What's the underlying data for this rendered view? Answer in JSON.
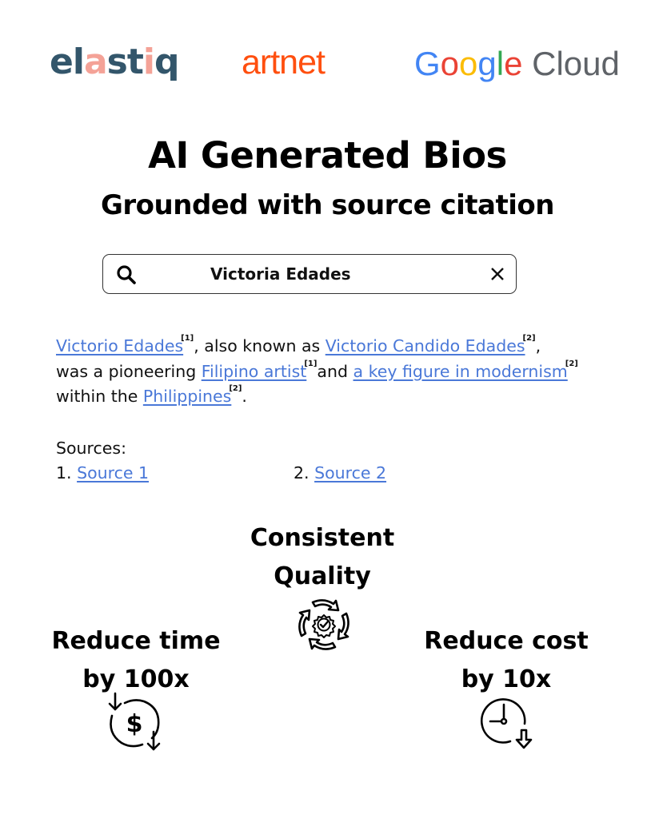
{
  "logos": {
    "elastiq": {
      "parts": [
        "el",
        "a",
        "st",
        "i",
        "q"
      ],
      "colors": {
        "primary": "#33566b",
        "accent": "#f4a297"
      }
    },
    "artnet": {
      "text": "artnet",
      "color": "#ff4f0f"
    },
    "google_cloud": {
      "google": [
        "G",
        "o",
        "o",
        "g",
        "l",
        "e"
      ],
      "cloud": "Cloud"
    }
  },
  "header": {
    "title": "AI Generated Bios",
    "subtitle": "Grounded with source citation"
  },
  "search": {
    "value": "Victoria Edades",
    "icon": "search-icon",
    "clear_icon": "close-icon"
  },
  "bio": {
    "link_color": "#4a78d8",
    "line1": {
      "link1": "Victorio Edades",
      "cite1": "[1]",
      "text1": ", also known as ",
      "link2": "Victorio Candido Edades",
      "cite2": "[2]",
      "text2": ","
    },
    "line2": {
      "text1": "was a pioneering ",
      "link1": "Filipino artist",
      "cite1": "[1]",
      "text2": "and ",
      "link2": "a key figure in modernism",
      "cite2": "[2]"
    },
    "line3": {
      "text1": "within the ",
      "link1": "Philippines",
      "cite1": "[2]",
      "text2": "."
    }
  },
  "sources": {
    "label": "Sources:",
    "items": [
      {
        "number": "1. ",
        "label": "Source 1"
      },
      {
        "number": "2. ",
        "label": "Source 2"
      }
    ]
  },
  "features": {
    "quality": {
      "line1": "Consistent",
      "line2": "Quality",
      "icon": "quality-cycle-icon"
    },
    "time": {
      "line1": "Reduce time",
      "line2": "by 100x",
      "icon": "dollar-cycle-down-icon"
    },
    "cost": {
      "line1": "Reduce cost",
      "line2": "by 10x",
      "icon": "clock-down-icon"
    }
  }
}
